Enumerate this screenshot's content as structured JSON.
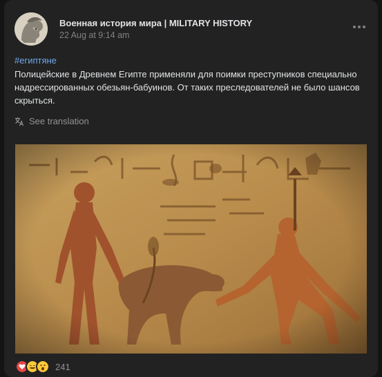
{
  "post": {
    "author": "Военная история мира | MILITARY HISTORY",
    "timestamp": "22 Aug at 9:14 am",
    "hashtag": "#египтяне",
    "text": "Полицейские в Древнем Египте применяли для поимки преступников специально надрессированных обезьян-бабуинов. От таких преследователей не было шансов скрыться.",
    "translate_label": "See translation",
    "reactions": {
      "icons": [
        "heart-reaction",
        "laughing-reaction",
        "surprised-reaction"
      ],
      "count": "241"
    }
  },
  "colors": {
    "card_bg": "#222222",
    "page_bg": "#141414",
    "link": "#71aaeb",
    "muted": "#828282",
    "heart": "#e64646",
    "emoji": "#ffc93c"
  },
  "icons": {
    "more": "more-horizontal-icon",
    "translate": "translate-icon"
  }
}
